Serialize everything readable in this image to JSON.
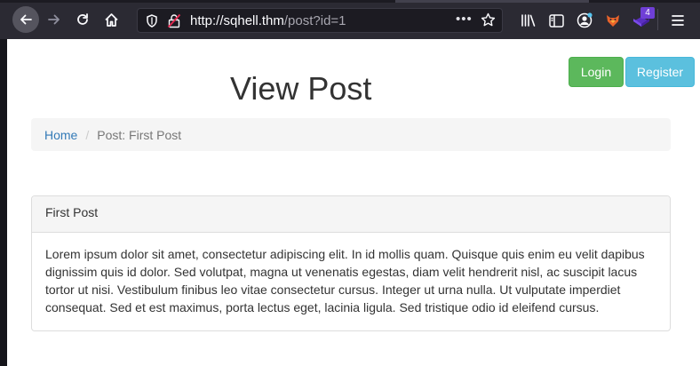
{
  "browser": {
    "url_host": "http://sqhell.thm",
    "url_path": "/post?id=1",
    "extension_badge": "4",
    "icons": [
      "back-icon",
      "forward-icon",
      "reload-icon",
      "home-icon",
      "shield-icon",
      "insecure-lock-icon",
      "more-icon",
      "bookmark-star-icon",
      "library-icon",
      "sidebar-icon",
      "account-icon",
      "foxyproxy-icon",
      "extension-icon",
      "menu-icon"
    ]
  },
  "header": {
    "login_label": "Login",
    "register_label": "Register",
    "title": "View Post"
  },
  "breadcrumb": {
    "home": "Home",
    "divider": "/",
    "current": "Post: First Post"
  },
  "post": {
    "title": "First Post",
    "body": "Lorem ipsum dolor sit amet, consectetur adipiscing elit. In id mollis quam. Quisque quis enim eu velit dapibus dignissim quis id dolor. Sed volutpat, magna ut venenatis egestas, diam velit hendrerit nisl, ac suscipit lacus tortor ut nisi. Vestibulum finibus leo vitae consectetur cursus. Integer ut urna nulla. Ut vulputate imperdiet consequat. Sed et est maximus, porta lectus eget, lacinia ligula. Sed tristique odio id eleifend cursus."
  },
  "colors": {
    "login_bg": "#5cb85c",
    "register_bg": "#5bc0de",
    "link": "#337ab7",
    "toolbar_bg": "#2b2a33"
  }
}
